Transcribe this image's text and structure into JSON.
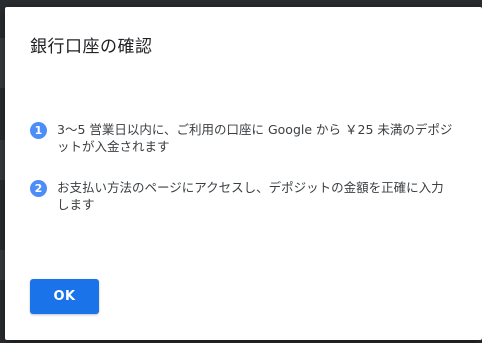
{
  "dialog": {
    "title": "銀行口座の確認",
    "steps": [
      {
        "number": "1",
        "text": "3～5 営業日以内に、ご利用の口座に Google から ￥25 未満のデポジットが入金されます"
      },
      {
        "number": "2",
        "text": "お支払い方法のページにアクセスし、デポジットの金額を正確に入力します"
      }
    ],
    "ok_label": "OK"
  },
  "colors": {
    "accent": "#1a73e8",
    "step_badge": "#4d8df7",
    "text": "#3c4043"
  }
}
